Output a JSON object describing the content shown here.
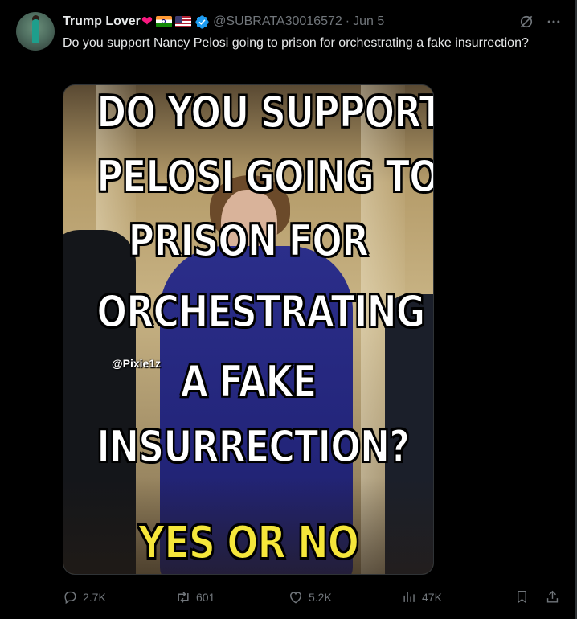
{
  "author": {
    "name": "Trump Lover",
    "handle": "@SUBRATA30016572",
    "date": "Jun 5",
    "verified": true,
    "name_emojis": [
      "red-heart",
      "india-flag",
      "usa-flag"
    ],
    "verified_color": "#1d9bf0"
  },
  "tweet": {
    "text": "Do you support Nancy Pelosi going to prison for orchestrating a fake insurrection?"
  },
  "media": {
    "lines": [
      "DO YOU SUPPORT",
      "PELOSI GOING TO",
      "PRISON FOR",
      "ORCHESTRATING",
      "A FAKE",
      "INSURRECTION?"
    ],
    "cta": "YES OR NO",
    "watermark": "@Pixie1z",
    "cta_color": "#f5e63a"
  },
  "actions": {
    "replies": "2.7K",
    "retweets": "601",
    "likes": "5.2K",
    "views": "47K"
  },
  "colors": {
    "background": "#000000",
    "text": "#e7e9ea",
    "muted": "#71767b",
    "accent_heart": "#f91880"
  }
}
